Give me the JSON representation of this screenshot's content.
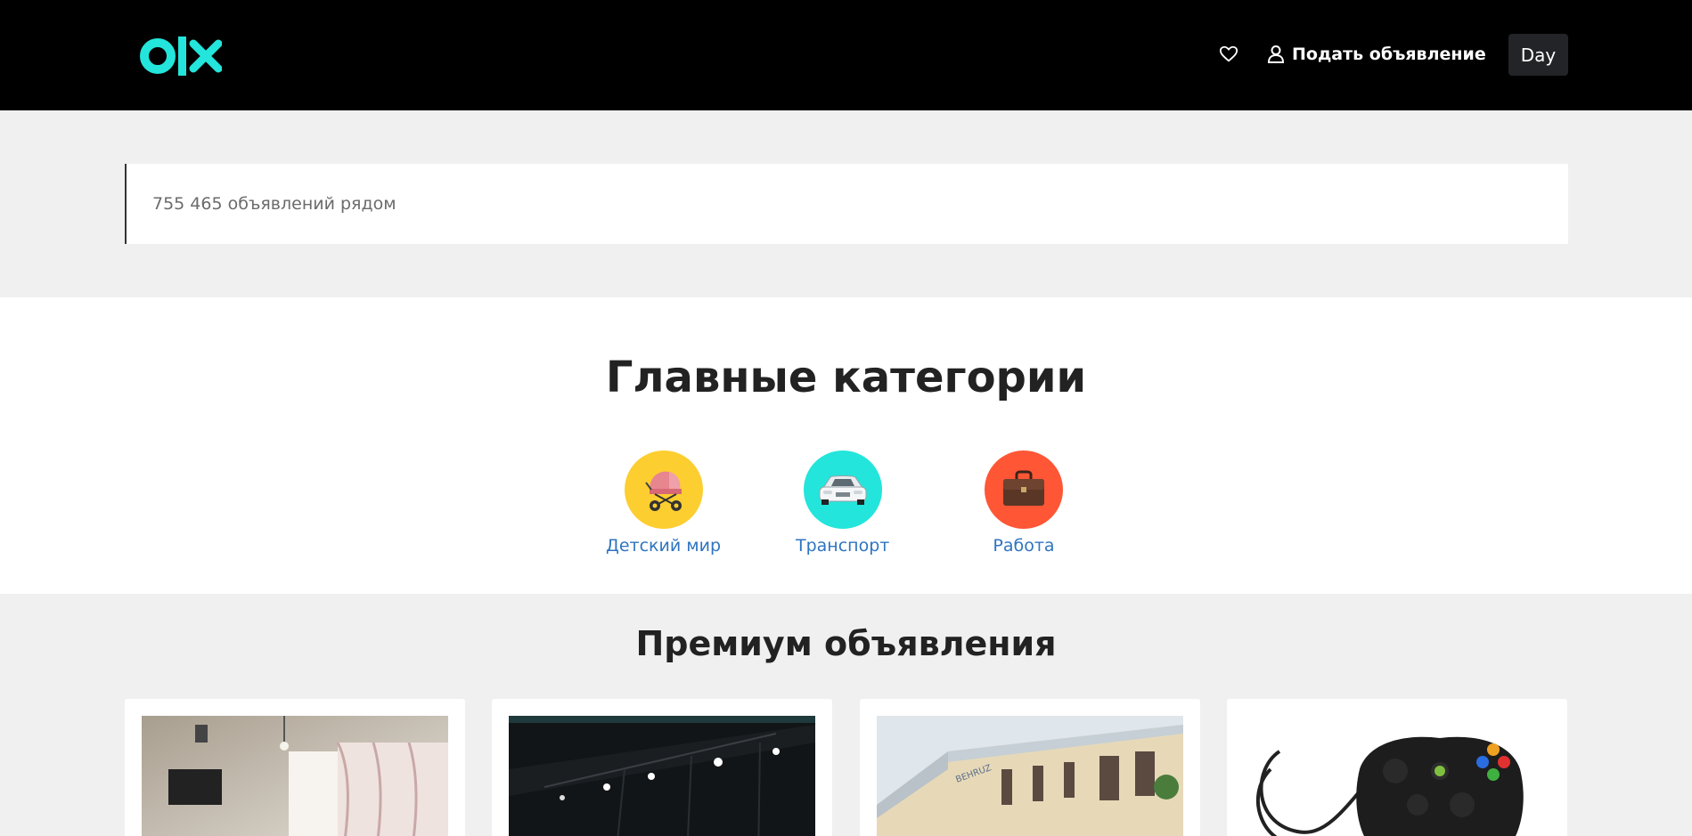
{
  "header": {
    "logo_text": "olx",
    "post_ad_label": "Подать объявление",
    "day_label": "Day"
  },
  "search": {
    "placeholder": "755 465 объявлений рядом"
  },
  "categories": {
    "title": "Главные категории",
    "items": [
      {
        "label": "Детский мир",
        "icon": "stroller-icon",
        "color": "#fdce30"
      },
      {
        "label": "Транспорт",
        "icon": "car-icon",
        "color": "#23e5db"
      },
      {
        "label": "Работа",
        "icon": "briefcase-icon",
        "color": "#ff5636"
      }
    ]
  },
  "premium": {
    "title": "Премиум объявления",
    "cards": [
      {
        "image": "room-photo"
      },
      {
        "image": "dark-interior-photo"
      },
      {
        "image": "building-photo"
      },
      {
        "image": "gamepad-photo"
      }
    ]
  },
  "colors": {
    "brand": "#23e5db",
    "header_bg": "#000000",
    "link": "#2f74c0"
  }
}
